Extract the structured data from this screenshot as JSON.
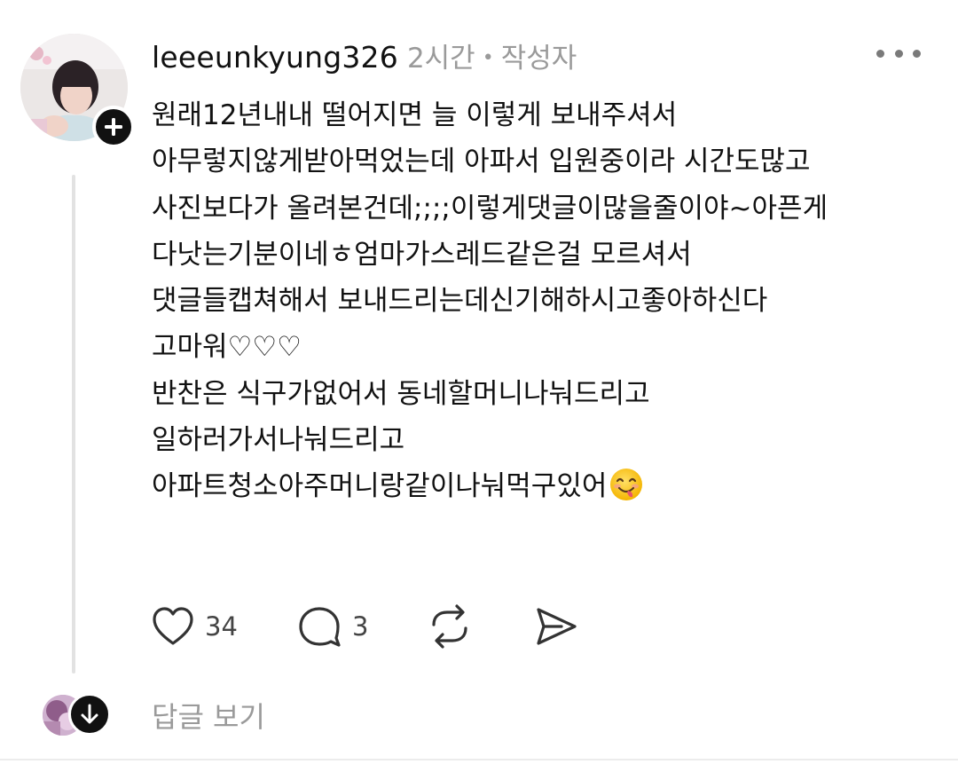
{
  "post": {
    "username": "leeeunkyung326",
    "time": "2시간",
    "separator": "•",
    "author_label": "작성자",
    "lines": [
      "원래12년내내 떨어지면 늘 이렇게 보내주셔서",
      "아무렇지않게받아먹었는데 아파서 입원중이라 시간도많고",
      "사진보다가 올려본건데;;;;이렇게댓글이많을줄이야~아픈게",
      "다낫는기분이네ㅎ엄마가스레드같은걸 모르셔서",
      "댓글들캡쳐해서 보내드리는데신기해하시고좋아하신다",
      "고마워♡♡♡",
      "반찬은 식구가없어서 동네할머니나눠드리고",
      "일하러가서나눠드리고",
      "아파트청소아주머니랑같이나눠먹구있어"
    ],
    "emoji_name": "face-savoring-food-emoji"
  },
  "actions": {
    "likes": "34",
    "comments": "3"
  },
  "replies": {
    "view_label": "답글 보기"
  },
  "icons": {
    "more": "more-options-icon",
    "like": "heart-icon",
    "comment": "comment-bubble-icon",
    "repost": "repost-icon",
    "share": "send-icon",
    "follow": "plus-icon",
    "expand": "arrow-down-icon"
  }
}
